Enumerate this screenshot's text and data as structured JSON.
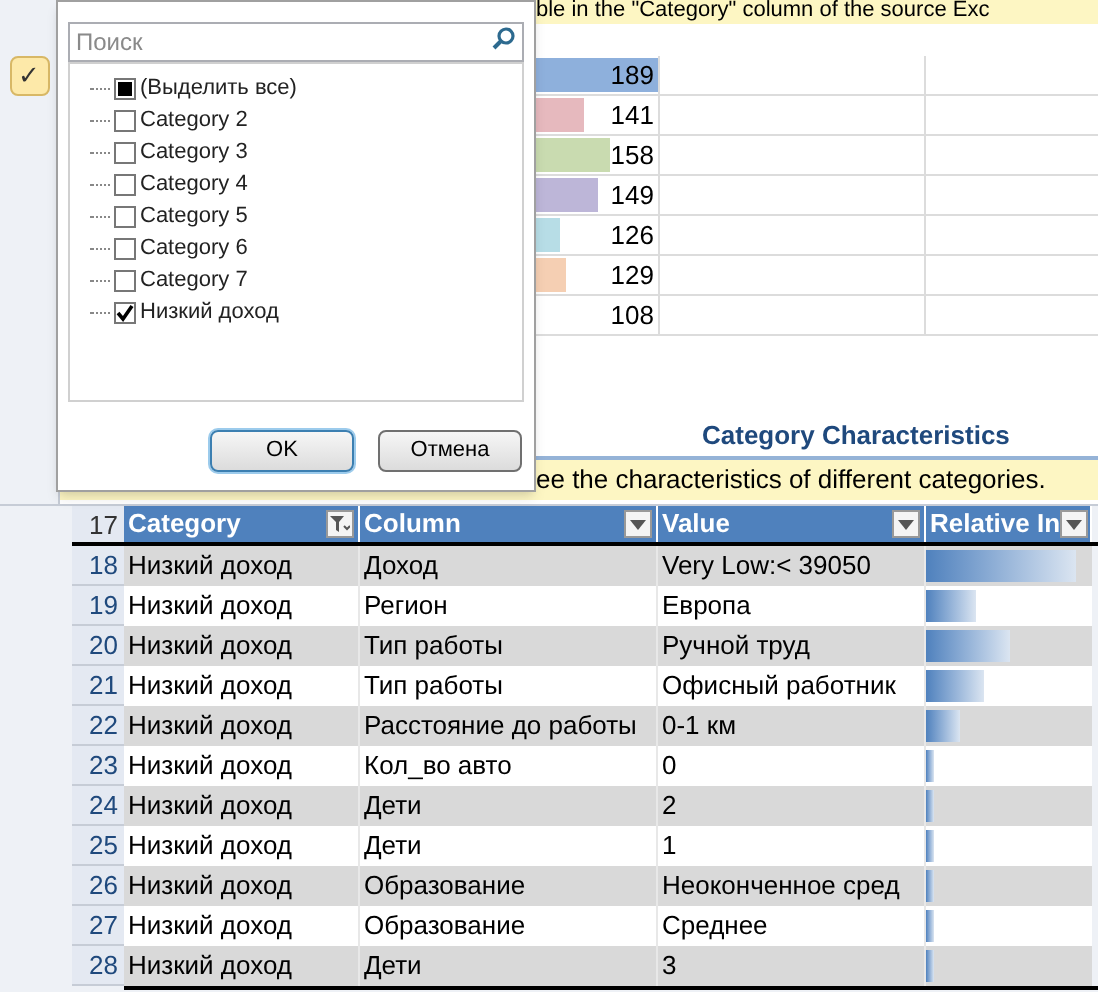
{
  "banner": "ble in the \"Category\" column of the source Exc",
  "side_check": "✓",
  "counts": [
    {
      "value": "189",
      "level": 1,
      "color": "#8eb0dc"
    },
    {
      "value": "141",
      "level": 0.4,
      "color": "#e6b9be"
    },
    {
      "value": "158",
      "level": 0.6,
      "color": "#c9dbb0"
    },
    {
      "value": "149",
      "level": 0.5,
      "color": "#bdb6d8"
    },
    {
      "value": "126",
      "level": 0.2,
      "color": "#b7dde6"
    },
    {
      "value": "129",
      "level": 0.25,
      "color": "#f5cfb3"
    },
    {
      "value": "108"
    }
  ],
  "section_title": "Category Characteristics",
  "note": "ee the characteristics of different categories.",
  "filter_popup": {
    "search": {
      "placeholder": "Поиск"
    },
    "items": [
      {
        "label": "(Выделить все)",
        "checked": false,
        "indeterminate": true
      },
      {
        "label": "Category 2",
        "checked": false
      },
      {
        "label": "Category 3",
        "checked": false
      },
      {
        "label": "Category 4",
        "checked": false
      },
      {
        "label": "Category 5",
        "checked": false
      },
      {
        "label": "Category 6",
        "checked": false
      },
      {
        "label": "Category 7",
        "checked": false
      },
      {
        "label": "Низкий доход",
        "checked": true
      }
    ],
    "buttons": [
      {
        "label": "OK",
        "default": true
      },
      {
        "label": "Отмена",
        "default": false
      }
    ]
  },
  "table": {
    "header_number": "17",
    "columns": [
      {
        "label": "Category",
        "filtered": true
      },
      {
        "label": "Column",
        "filtered": false
      },
      {
        "label": "Value",
        "filtered": false
      },
      {
        "label": "Relative In",
        "filtered": false
      }
    ],
    "rows": [
      {
        "number": "18",
        "cells": [
          "Низкий доход",
          "Доход",
          "Very Low:< 39050"
        ],
        "level": 0.9
      },
      {
        "number": "19",
        "cells": [
          "Низкий доход",
          "Регион",
          "Европа"
        ],
        "level": 0.3
      },
      {
        "number": "20",
        "cells": [
          "Низкий доход",
          "Тип работы",
          "Ручной труд"
        ],
        "level": 0.5
      },
      {
        "number": "21",
        "cells": [
          "Низкий доход",
          "Тип работы",
          "Офисный работник"
        ],
        "level": 0.35
      },
      {
        "number": "22",
        "cells": [
          "Низкий доход",
          "Расстояние до работы",
          "0-1 км"
        ],
        "level": 0.2
      },
      {
        "number": "23",
        "cells": [
          "Низкий доход",
          "Кол_во авто",
          "0"
        ],
        "level": 0.05
      },
      {
        "number": "24",
        "cells": [
          "Низкий доход",
          "Дети",
          "2"
        ],
        "level": 0.05
      },
      {
        "number": "25",
        "cells": [
          "Низкий доход",
          "Дети",
          "1"
        ],
        "level": 0.05
      },
      {
        "number": "26",
        "cells": [
          "Низкий доход",
          "Образование",
          "Неоконченное сред"
        ],
        "level": 0.05
      },
      {
        "number": "27",
        "cells": [
          "Низкий доход",
          "Образование",
          "Среднее"
        ],
        "level": 0.05
      },
      {
        "number": "28",
        "cells": [
          "Низкий доход",
          "Дети",
          "3"
        ],
        "level": 0.05
      }
    ]
  }
}
